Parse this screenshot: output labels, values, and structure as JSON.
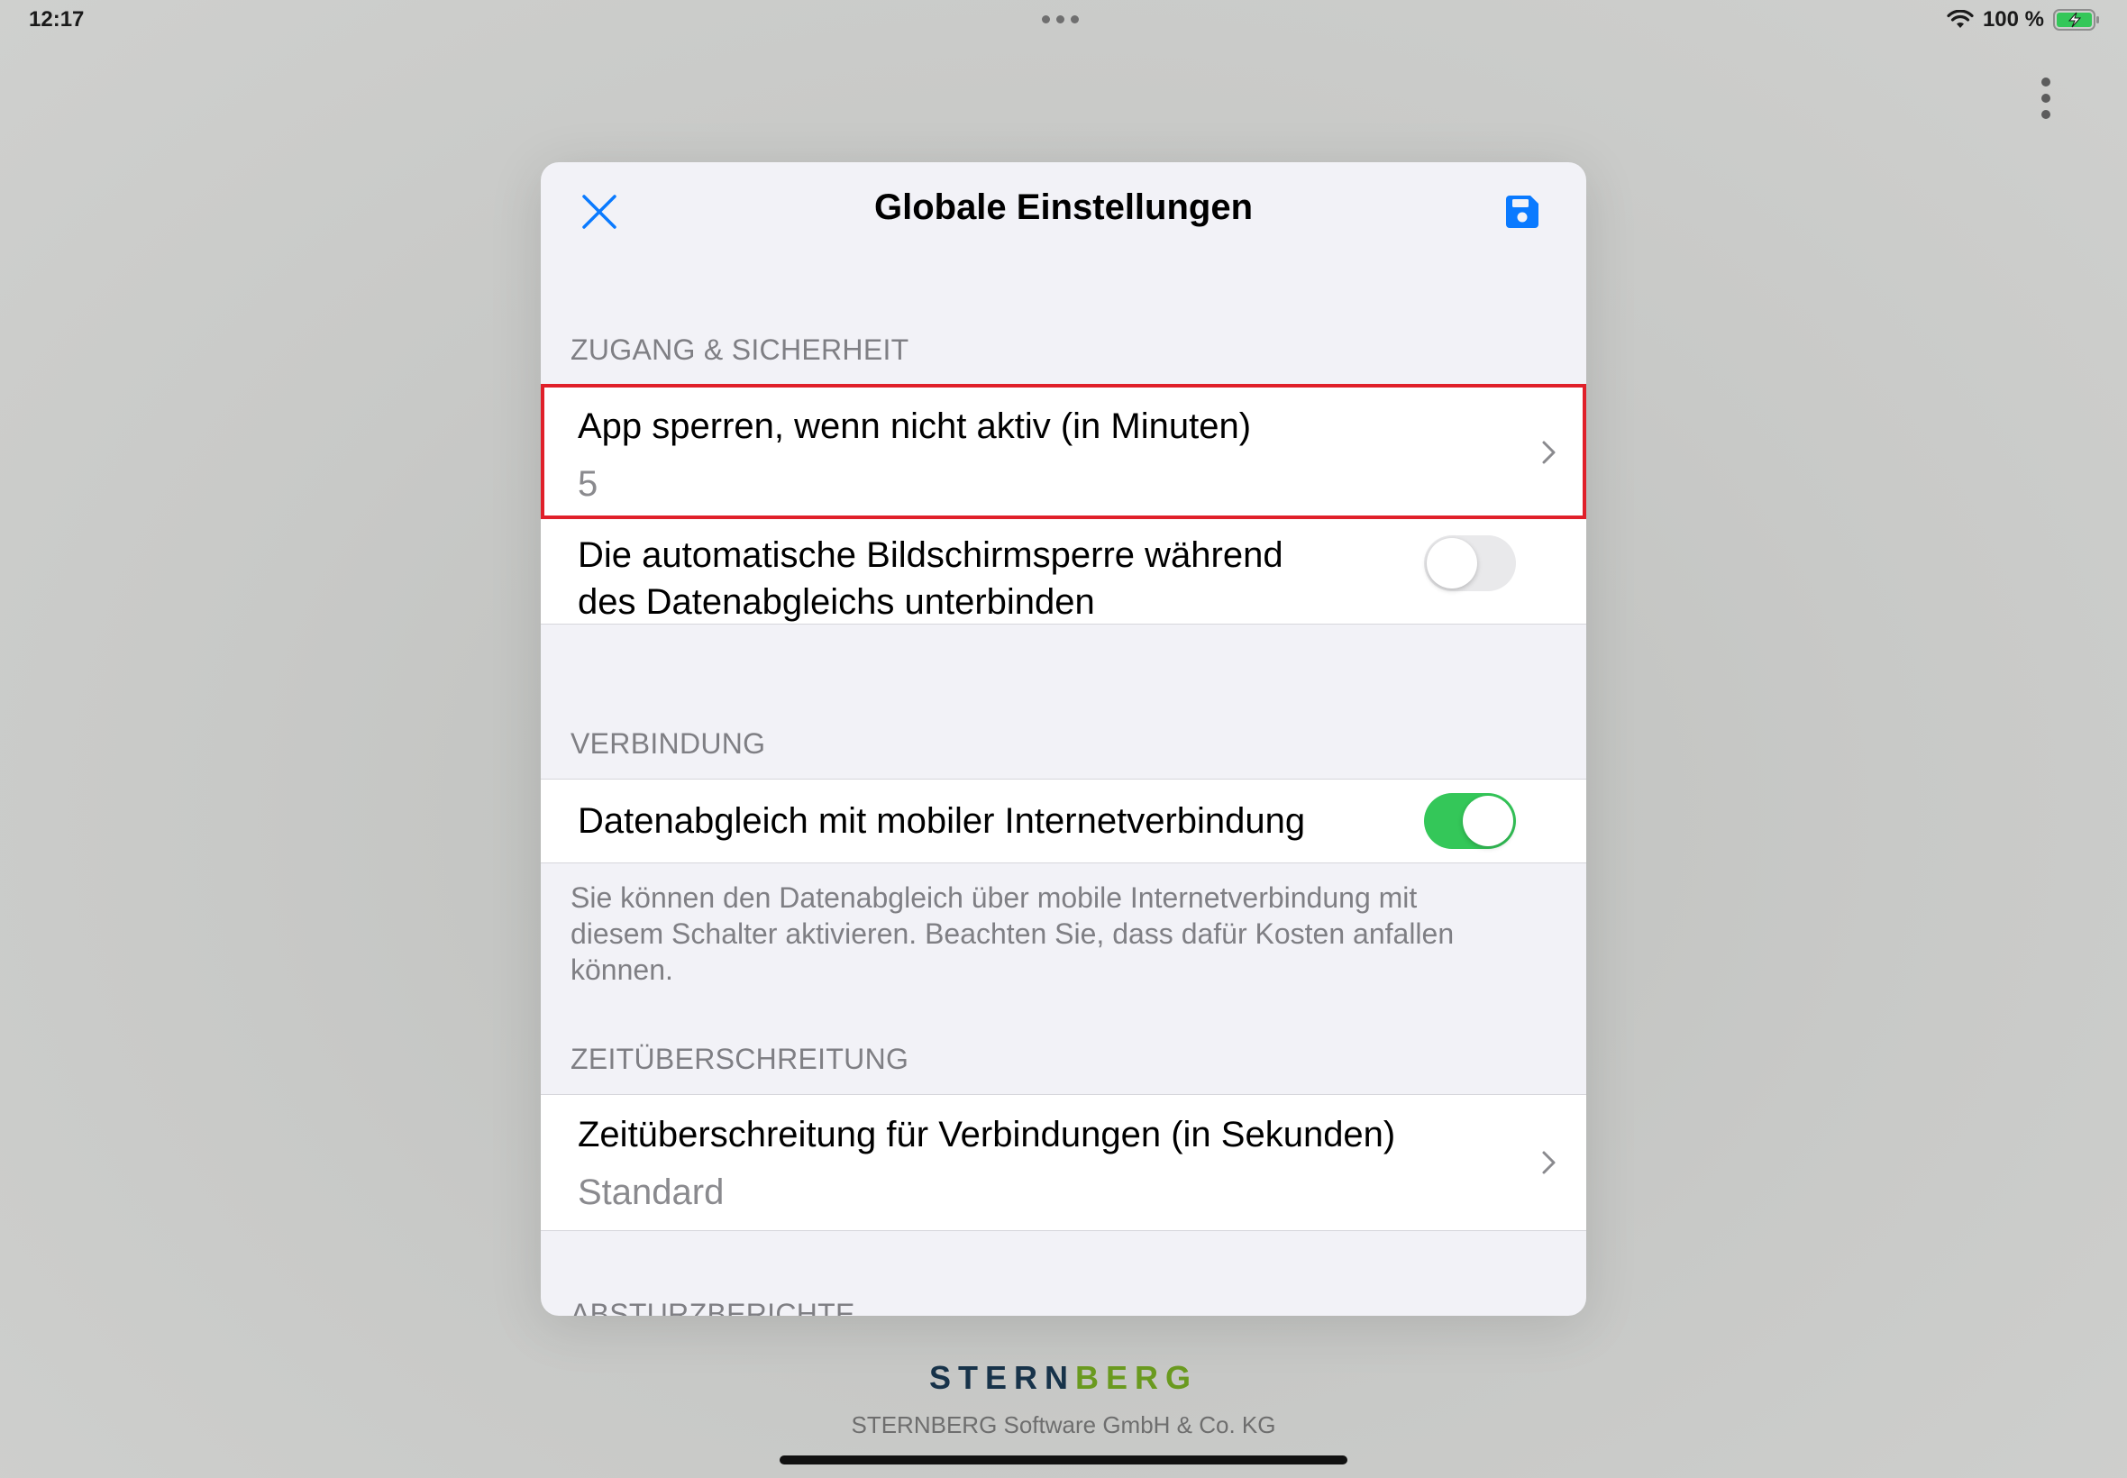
{
  "status_bar": {
    "time": "12:17",
    "battery_percent": "100 %",
    "wifi_icon": "wifi-icon",
    "battery_icon": "battery-charging-icon"
  },
  "sheet": {
    "title": "Globale Einstellungen",
    "close_icon": "close-icon",
    "save_icon": "save-icon"
  },
  "sections": {
    "security": {
      "header": "ZUGANG & SICHERHEIT",
      "lock_app": {
        "title": "App sperren, wenn nicht aktiv (in Minuten)",
        "value": "5"
      },
      "screen_lock": {
        "title_line1": "Die automatische Bildschirmsperre während",
        "title_line2": "des Datenabgleichs unterbinden",
        "enabled": false
      }
    },
    "connection": {
      "header": "VERBINDUNG",
      "mobile_sync": {
        "title": "Datenabgleich mit mobiler Internetverbindung",
        "enabled": true
      },
      "footer_line1": "Sie können den Datenabgleich über mobile Internetverbindung mit",
      "footer_line2": "diesem Schalter aktivieren. Beachten Sie, dass dafür Kosten anfallen",
      "footer_line3": "können."
    },
    "timeout": {
      "header": "ZEITÜBERSCHREITUNG",
      "connection_timeout": {
        "title": "Zeitüberschreitung für Verbindungen (in Sekunden)",
        "value": "Standard"
      }
    },
    "crash_reports": {
      "header": "ABSTURZBERICHTE"
    }
  },
  "branding": {
    "logo_part1": "STERN",
    "logo_part2": "BERG",
    "company": "STERNBERG Software GmbH & Co. KG"
  },
  "colors": {
    "accent": "#0a7aff",
    "toggle_on": "#34c759",
    "highlight": "#e0202a"
  }
}
